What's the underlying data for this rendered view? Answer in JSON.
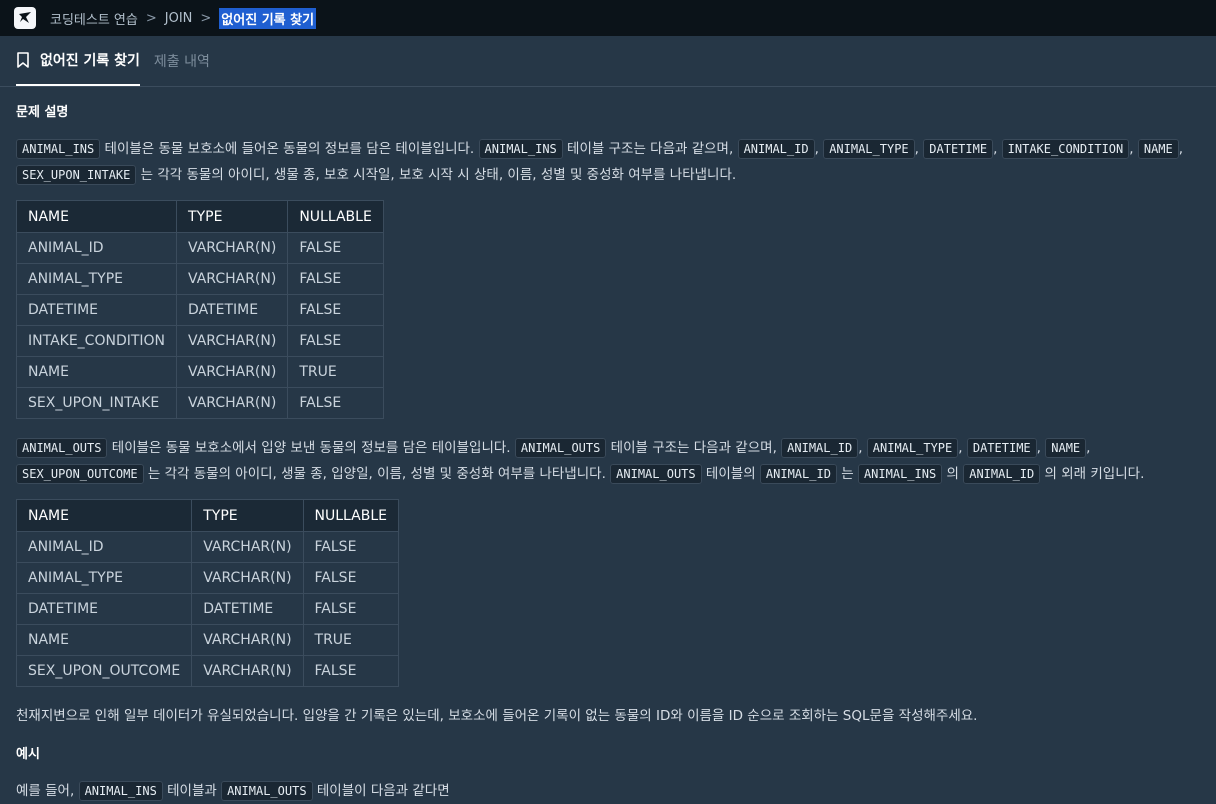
{
  "breadcrumb": {
    "items": [
      "코딩테스트 연습",
      "JOIN"
    ],
    "current": "없어진 기록 찾기",
    "separator": ">"
  },
  "tabs": [
    {
      "label": "없어진 기록 찾기",
      "active": true
    },
    {
      "label": "제출 내역",
      "active": false
    }
  ],
  "section1": {
    "title": "문제 설명"
  },
  "para1": {
    "c1": "ANIMAL_INS",
    "t1": " 테이블은 동물 보호소에 들어온 동물의 정보를 담은 테이블입니다. ",
    "c2": "ANIMAL_INS",
    "t2": " 테이블 구조는 다음과 같으며, ",
    "c3": "ANIMAL_ID",
    "t3": ", ",
    "c4": "ANIMAL_TYPE",
    "t4": ", ",
    "c5": "DATETIME",
    "t5": ", ",
    "c6": "INTAKE_CONDITION",
    "t6": ", ",
    "c7": "NAME",
    "t7": ", ",
    "c8": "SEX_UPON_INTAKE",
    "t8": " 는 각각 동물의 아이디, 생물 종, 보호 시작일, 보호 시작 시 상태, 이름, 성별 및 중성화 여부를 나타냅니다."
  },
  "table1": {
    "headers": [
      "NAME",
      "TYPE",
      "NULLABLE"
    ],
    "rows": [
      [
        "ANIMAL_ID",
        "VARCHAR(N)",
        "FALSE"
      ],
      [
        "ANIMAL_TYPE",
        "VARCHAR(N)",
        "FALSE"
      ],
      [
        "DATETIME",
        "DATETIME",
        "FALSE"
      ],
      [
        "INTAKE_CONDITION",
        "VARCHAR(N)",
        "FALSE"
      ],
      [
        "NAME",
        "VARCHAR(N)",
        "TRUE"
      ],
      [
        "SEX_UPON_INTAKE",
        "VARCHAR(N)",
        "FALSE"
      ]
    ]
  },
  "para2": {
    "c1": "ANIMAL_OUTS",
    "t1": " 테이블은 동물 보호소에서 입양 보낸 동물의 정보를 담은 테이블입니다. ",
    "c2": "ANIMAL_OUTS",
    "t2": " 테이블 구조는 다음과 같으며, ",
    "c3": "ANIMAL_ID",
    "t3": ", ",
    "c4": "ANIMAL_TYPE",
    "t4": ", ",
    "c5": "DATETIME",
    "t5": ", ",
    "c6": "NAME",
    "t6": ", ",
    "c7": "SEX_UPON_OUTCOME",
    "t7": " 는 각각 동물의 아이디, 생물 종, 입양일, 이름, 성별 및 중성화 여부를 나타냅니다. ",
    "c8": "ANIMAL_OUTS",
    "t8": " 테이블의 ",
    "c9": "ANIMAL_ID",
    "t9": " 는 ",
    "c10": "ANIMAL_INS",
    "t10": " 의 ",
    "c11": "ANIMAL_ID",
    "t11": " 의 외래 키입니다."
  },
  "table2": {
    "headers": [
      "NAME",
      "TYPE",
      "NULLABLE"
    ],
    "rows": [
      [
        "ANIMAL_ID",
        "VARCHAR(N)",
        "FALSE"
      ],
      [
        "ANIMAL_TYPE",
        "VARCHAR(N)",
        "FALSE"
      ],
      [
        "DATETIME",
        "DATETIME",
        "FALSE"
      ],
      [
        "NAME",
        "VARCHAR(N)",
        "TRUE"
      ],
      [
        "SEX_UPON_OUTCOME",
        "VARCHAR(N)",
        "FALSE"
      ]
    ]
  },
  "question": "천재지변으로 인해 일부 데이터가 유실되었습니다. 입양을 간 기록은 있는데, 보호소에 들어온 기록이 없는 동물의 ID와 이름을 ID 순으로 조회하는 SQL문을 작성해주세요.",
  "section2": {
    "title": "예시"
  },
  "para3": {
    "t0": "예를 들어, ",
    "c1": "ANIMAL_INS",
    "t1": " 테이블과 ",
    "c2": "ANIMAL_OUTS",
    "t2": " 테이블이 다음과 같다면"
  },
  "colors": {
    "background": "#263747",
    "topbar": "#0b1319",
    "highlight": "#1f5fd1"
  },
  "icons": {
    "logo": "programmers-logo-icon",
    "bookmark": "bookmark-icon",
    "chevron": "chevron-right-icon"
  }
}
